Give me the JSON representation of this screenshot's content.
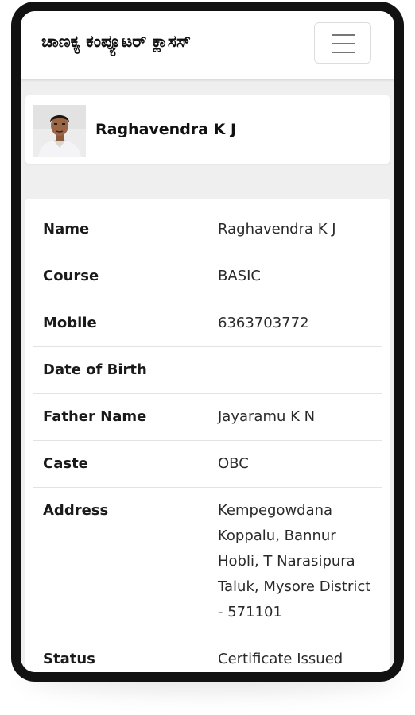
{
  "navbar": {
    "brand": "ಚಾಣಕ್ಯ ಕಂಪ್ಯೂಟರ್ ಕ್ಲಾಸಸ್",
    "menu_icon": "hamburger-menu-icon"
  },
  "profile": {
    "name": "Raghavendra K J",
    "photo_icon": "student-photo"
  },
  "details": {
    "rows": [
      {
        "label": "Name",
        "value": "Raghavendra K J"
      },
      {
        "label": "Course",
        "value": "BASIC"
      },
      {
        "label": "Mobile",
        "value": "6363703772"
      },
      {
        "label": "Date of Birth",
        "value": ""
      },
      {
        "label": "Father Name",
        "value": "Jayaramu K N"
      },
      {
        "label": "Caste",
        "value": "OBC"
      },
      {
        "label": "Address",
        "value": "Kempegowdana Koppalu, Bannur Hobli, T Narasipura Taluk, Mysore District - 571101"
      },
      {
        "label": "Status",
        "value": "Certificate Issued"
      }
    ]
  },
  "colors": {
    "frame": "#111111",
    "screen_bg": "#efefef",
    "card_bg": "#ffffff",
    "divider": "#e3e3e3"
  }
}
